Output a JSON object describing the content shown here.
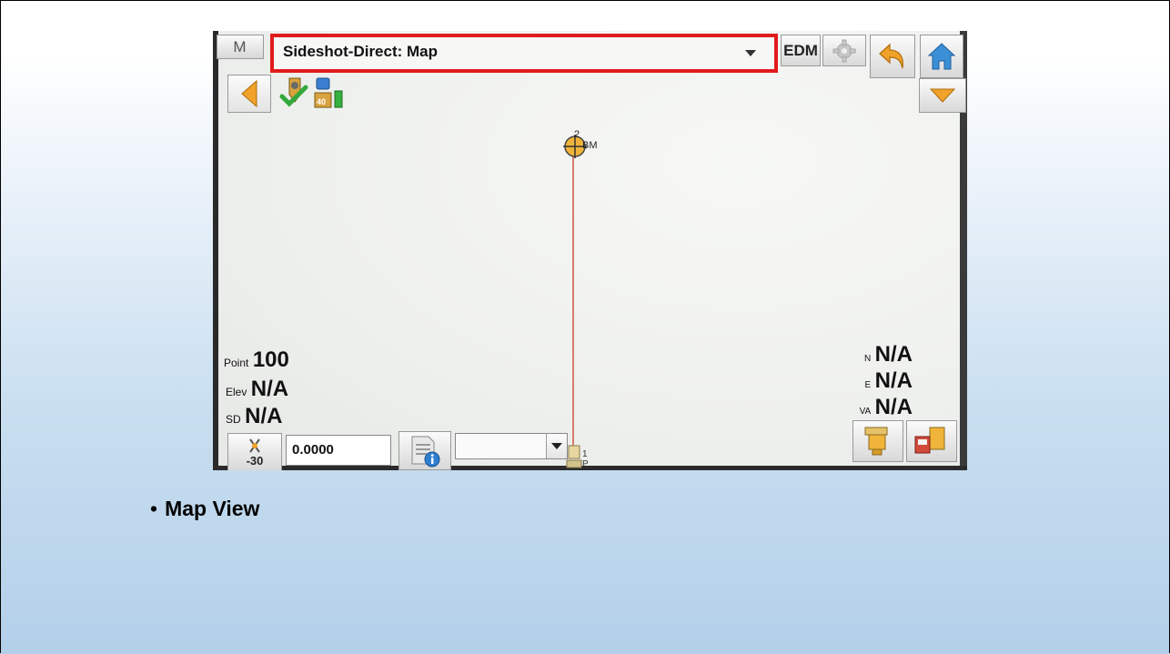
{
  "header": {
    "mode_label": "M",
    "title": "Sideshot-Direct: Map",
    "edm_label": "EDM"
  },
  "map": {
    "backsight_label": "BM",
    "backsight_number": "2",
    "occupied_number": "1",
    "occupied_label": "P"
  },
  "readouts": {
    "point_label": "Point",
    "point_value": "100",
    "elev_label": "Elev",
    "elev_value": "N/A",
    "sd_label": "SD",
    "sd_value": "N/A",
    "n_label": "N",
    "n_value": "N/A",
    "e_label": "E",
    "e_value": "N/A",
    "va_label": "VA",
    "va_value": "N/A"
  },
  "toolbar": {
    "prism_constant": "-30",
    "height_value": "0.0000",
    "code_value": ""
  },
  "status": {
    "battery_level_label": "40"
  },
  "caption": {
    "bullet": "•",
    "text": "Map View"
  },
  "colors": {
    "highlight_box": "#e11b1b",
    "accent_orange": "#f0a22a",
    "home_blue": "#3a8fd6",
    "traverse_line": "#d9796b"
  }
}
